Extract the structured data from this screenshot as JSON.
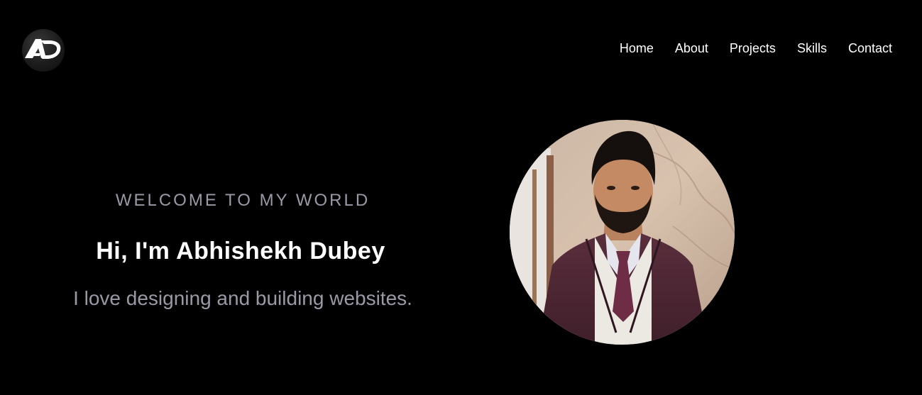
{
  "header": {
    "logo_icon": "ad-monogram-logo-icon",
    "nav": [
      {
        "label": "Home"
      },
      {
        "label": "About"
      },
      {
        "label": "Projects"
      },
      {
        "label": "Skills"
      },
      {
        "label": "Contact"
      }
    ]
  },
  "hero": {
    "eyebrow": "WELCOME TO MY WORLD",
    "headline": "Hi, I'm Abhishekh Dubey",
    "tagline": "I love designing and building websites.",
    "portrait_icon": "profile-photo"
  },
  "colors": {
    "background": "#000000",
    "text_primary": "#ffffff",
    "text_muted": "#9a9aa6"
  }
}
